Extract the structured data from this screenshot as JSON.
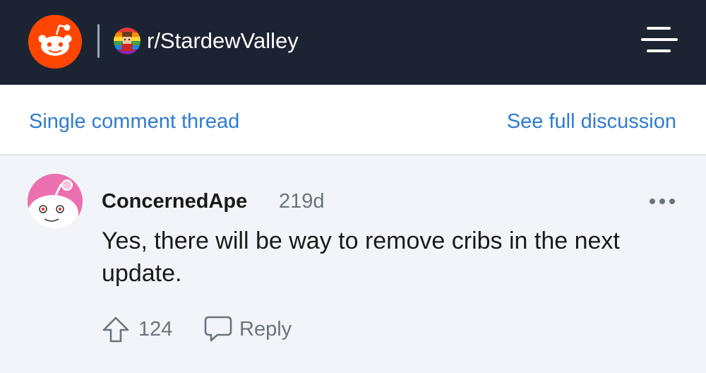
{
  "header": {
    "logo_icon": "reddit-snoo-icon",
    "subreddit_icon": "stardew-valley-subreddit-icon",
    "subreddit_name": "r/StardewValley",
    "menu_icon": "hamburger-menu-icon",
    "background_color": "#1c2433",
    "logo_color": "#ff4500"
  },
  "nav": {
    "left_link": "Single comment thread",
    "right_link": "See full discussion",
    "link_color": "#2f7ccc"
  },
  "comment": {
    "avatar_icon": "snoo-avatar-icon",
    "author": "ConcernedApe",
    "age": "219d",
    "more_icon": "more-options-icon",
    "body": "Yes, there will be way to remove cribs in the next update.",
    "upvote_icon": "upvote-arrow-icon",
    "score": "124",
    "reply_icon": "reply-bubble-icon",
    "reply_label": "Reply"
  }
}
